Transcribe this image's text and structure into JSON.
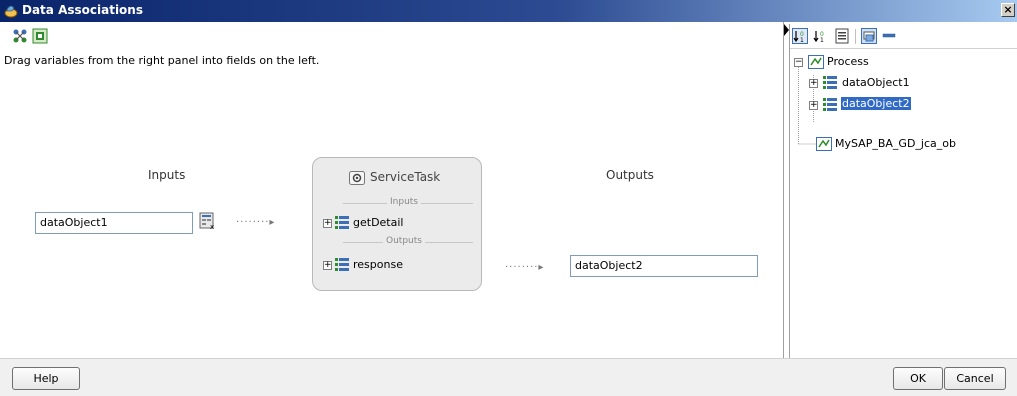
{
  "window": {
    "title": "Data Associations",
    "close_glyph": "×"
  },
  "instructions": "Drag variables from the right panel into fields on the left.",
  "inputs_title": "Inputs",
  "outputs_title": "Outputs",
  "input_field": {
    "value": "dataObject1"
  },
  "output_field": {
    "value": "dataObject2"
  },
  "service_task": {
    "title": "ServiceTask",
    "inputs_label": "Inputs",
    "outputs_label": "Outputs",
    "input_arg": "getDetail",
    "output_arg": "response",
    "expand_glyph": "+"
  },
  "right_tree": {
    "root": "Process",
    "children": [
      "dataObject1",
      "dataObject2"
    ],
    "service": "MySAP_BA_GD_jca_ob",
    "selected": "dataObject2"
  },
  "buttons": {
    "help": "Help",
    "ok": "OK",
    "cancel": "Cancel"
  },
  "colors": {
    "title_bar": "#0a246a",
    "selection": "#316ac5",
    "icon_green": "#2e8b2e",
    "icon_blue": "#3d6fb6"
  },
  "icons": [
    "app-icon",
    "close-icon",
    "expand-all-icon",
    "collapse-all-icon",
    "variable-picker-icon",
    "service-task-icon",
    "tree-node-icon"
  ]
}
